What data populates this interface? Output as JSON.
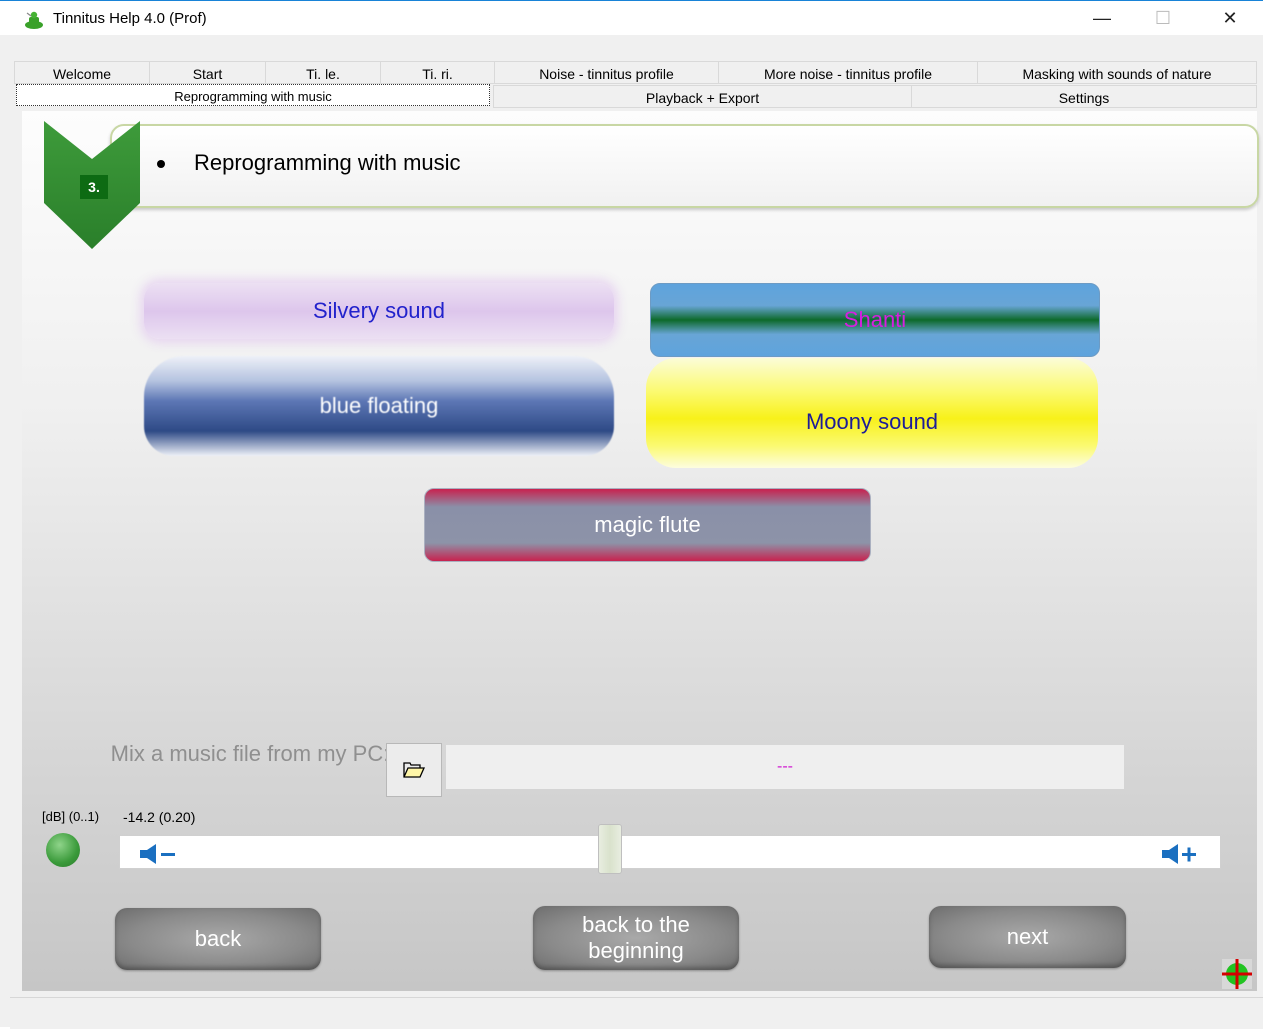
{
  "window": {
    "title": "Tinnitus Help 4.0 (Prof)",
    "minimize_glyph": "—",
    "maximize_glyph": "☐",
    "close_glyph": "✕"
  },
  "tabs_row1": [
    "Welcome",
    "Start",
    "Ti. le.",
    "Ti. ri.",
    "Noise - tinnitus profile",
    "More noise - tinnitus profile",
    "Masking with sounds of nature"
  ],
  "tabs_row2": [
    "Reprogramming with music",
    "Playback + Export",
    "Settings"
  ],
  "header": {
    "step": "3.",
    "title": "Reprogramming with music"
  },
  "music_buttons": {
    "silvery": "Silvery sound",
    "shanti": "Shanti",
    "blue": "blue floating",
    "moony": "Moony sound",
    "flute": "magic flute"
  },
  "mix": {
    "label": "Mix a music file from my PC:",
    "file": "---",
    "folder_icon": "folder-icon"
  },
  "volume": {
    "db_label": "[dB] (0..1)",
    "value_text": "-14.2 (0.20)",
    "level": 0.2
  },
  "nav": {
    "back": "back",
    "beginning": "back to the beginning",
    "next": "next"
  },
  "colors": {
    "accent_green": "#0d6b13",
    "title_border": "#1883d7"
  }
}
